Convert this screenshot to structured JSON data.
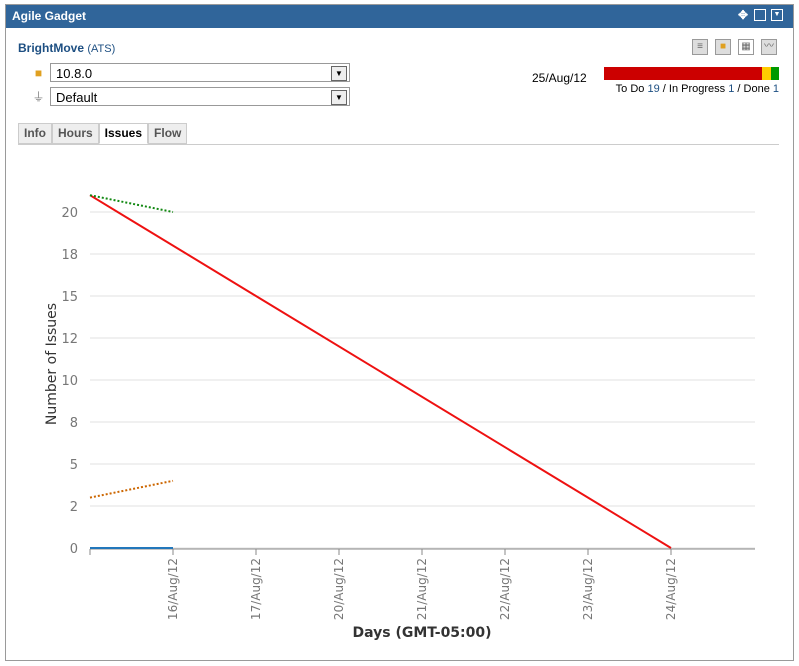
{
  "gadget": {
    "title": "Agile Gadget",
    "header_icons": [
      "move-icon",
      "maximize-icon",
      "menu-dropdown-icon"
    ]
  },
  "project": {
    "name": "BrightMove",
    "key": "(ATS)"
  },
  "version_select": {
    "value": "10.8.0"
  },
  "filter_select": {
    "value": "Default"
  },
  "tabs": [
    {
      "label": "Info"
    },
    {
      "label": "Hours"
    },
    {
      "label": "Issues",
      "active": true
    },
    {
      "label": "Flow"
    }
  ],
  "toolbar_icons": [
    "list-icon",
    "version-icon",
    "grid-icon",
    "chart-icon"
  ],
  "status": {
    "date": "25/Aug/12",
    "todo_label": "To Do",
    "todo": "19",
    "inprogress_label": "In Progress",
    "inprogress": "1",
    "done_label": "Done",
    "done": "1",
    "colors": {
      "todo": "#cc0000",
      "inprogress": "#ffcc00",
      "done": "#009900"
    }
  },
  "chart_data": {
    "type": "line",
    "ylabel": "Number of Issues",
    "xlabel": "Days (GMT-05:00)",
    "x": [
      "",
      "16/Aug/12",
      "17/Aug/12",
      "20/Aug/12",
      "21/Aug/12",
      "22/Aug/12",
      "23/Aug/12",
      "24/Aug/12"
    ],
    "ylim": [
      0,
      21
    ],
    "yticks": [
      0,
      2.5,
      5,
      7.5,
      10,
      12.5,
      15,
      17.5,
      20
    ],
    "ytick_labels": [
      "0",
      "2",
      "5",
      "8",
      "10",
      "12",
      "15",
      "18",
      "20"
    ],
    "grid": true,
    "series": [
      {
        "color": "#ee1111",
        "style": "solid",
        "values": [
          21,
          null,
          null,
          null,
          null,
          null,
          null,
          0
        ]
      },
      {
        "color": "#118811",
        "style": "dotted",
        "values": [
          21,
          20
        ]
      },
      {
        "color": "#cc6600",
        "style": "dotted",
        "values": [
          3,
          4
        ]
      },
      {
        "color": "#2277bb",
        "style": "solid",
        "values": [
          0,
          0
        ]
      }
    ]
  }
}
